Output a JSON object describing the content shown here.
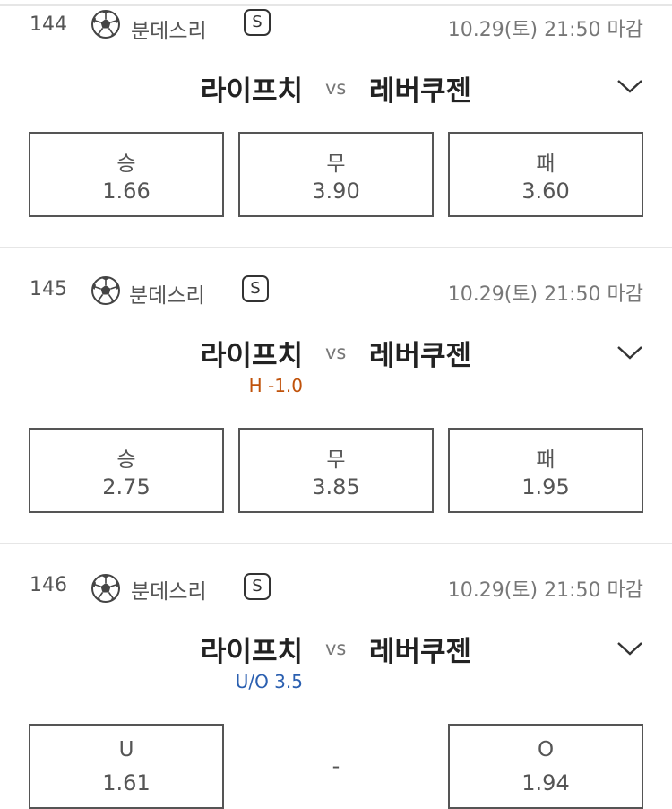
{
  "colors": {
    "handicap_label": "#c0520a",
    "uo_label": "#2a5fb0",
    "border": "#555555",
    "divider": "#e6e6e6"
  },
  "matches": [
    {
      "number": "144",
      "sport_icon": "soccer-ball-icon",
      "league": "분데스리",
      "badge": "S",
      "deadline": "10.29(토) 21:50 마감",
      "home": "라이프치",
      "vs": "vs",
      "away": "레버쿠젠",
      "sub_label": "",
      "options": [
        {
          "label": "승",
          "value": "1.66"
        },
        {
          "label": "무",
          "value": "3.90"
        },
        {
          "label": "패",
          "value": "3.60"
        }
      ]
    },
    {
      "number": "145",
      "sport_icon": "soccer-ball-icon",
      "league": "분데스리",
      "badge": "S",
      "deadline": "10.29(토) 21:50 마감",
      "home": "라이프치",
      "vs": "vs",
      "away": "레버쿠젠",
      "sub_label": "H -1.0",
      "options": [
        {
          "label": "승",
          "value": "2.75"
        },
        {
          "label": "무",
          "value": "3.85"
        },
        {
          "label": "패",
          "value": "1.95"
        }
      ]
    },
    {
      "number": "146",
      "sport_icon": "soccer-ball-icon",
      "league": "분데스리",
      "badge": "S",
      "deadline": "10.29(토) 21:50 마감",
      "home": "라이프치",
      "vs": "vs",
      "away": "레버쿠젠",
      "sub_label": "U/O 3.5",
      "middle_placeholder": "-",
      "options": [
        {
          "label": "U",
          "value": "1.61"
        },
        {
          "label": "O",
          "value": "1.94"
        }
      ]
    }
  ]
}
